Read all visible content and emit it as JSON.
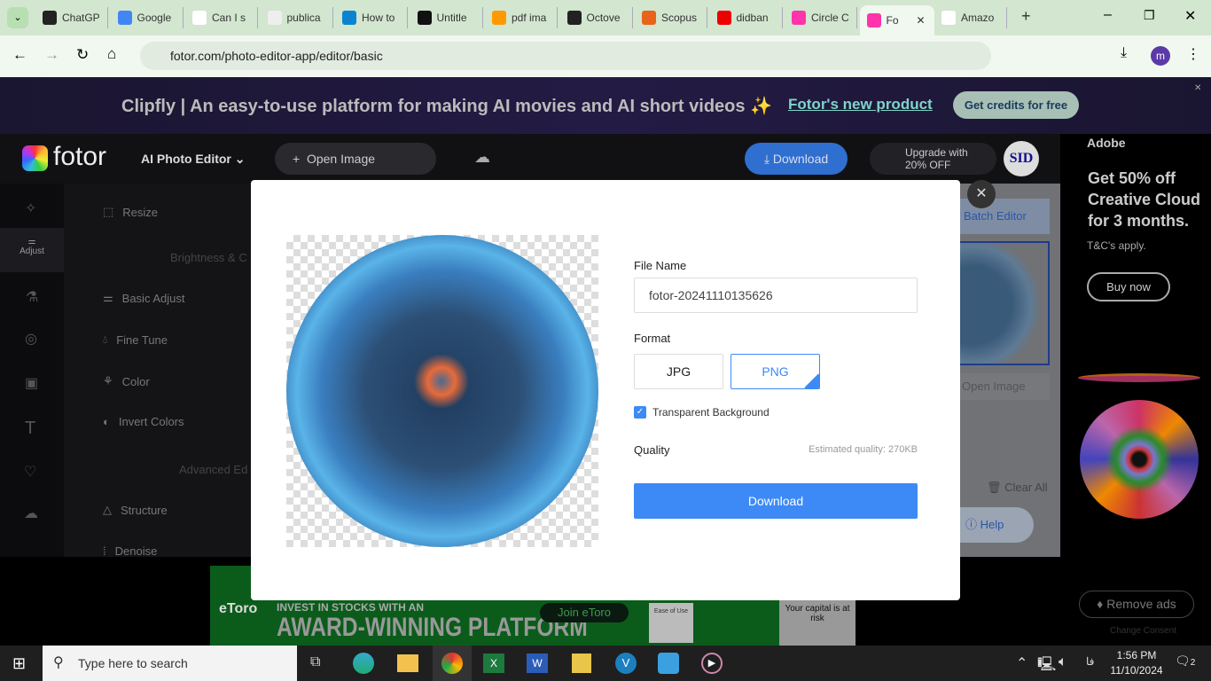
{
  "browser": {
    "tabs": [
      {
        "label": "ChatGP",
        "icon": "chatgpt-icon"
      },
      {
        "label": "Google",
        "icon": "google-translate-icon"
      },
      {
        "label": "Can I s",
        "icon": "google-icon"
      },
      {
        "label": "publica",
        "icon": "publication-icon"
      },
      {
        "label": "How to",
        "icon": "a-icon"
      },
      {
        "label": "Untitle",
        "icon": "untitled-icon"
      },
      {
        "label": "pdf ima",
        "icon": "pdf-icon"
      },
      {
        "label": "Octove",
        "icon": "github-icon"
      },
      {
        "label": "Scopus",
        "icon": "scopus-icon"
      },
      {
        "label": "didban",
        "icon": "youtube-icon"
      },
      {
        "label": "Circle C",
        "icon": "fotor-icon"
      },
      {
        "label": "Fo",
        "icon": "fotor-icon",
        "active": true
      },
      {
        "label": "Amazo",
        "icon": "amazon-icon"
      }
    ],
    "url": "fotor.com/photo-editor-app/editor/basic",
    "profile": "m"
  },
  "banner": {
    "text": "Clipfly | An easy-to-use platform for making AI movies and AI short videos ✨",
    "link": "Fotor's new product",
    "button": "Get credits for free"
  },
  "header": {
    "logo": "fotor",
    "editor": "AI Photo Editor",
    "open_image": "Open Image",
    "download": "Download",
    "upgrade_line1": "Upgrade with",
    "upgrade_line2": "20% OFF",
    "avatar": "SID"
  },
  "rail": {
    "adjust": "Adjust"
  },
  "panel": {
    "resize": "Resize",
    "section1": "Brightness & C",
    "basic": "Basic Adjust",
    "fine": "Fine Tune",
    "color": "Color",
    "invert": "Invert Colors",
    "section2": "Advanced Ed",
    "structure": "Structure",
    "denoise": "Denoise"
  },
  "right_panel": {
    "batch": "Batch Editor",
    "open": "Open Image",
    "clear": "Clear All",
    "help": "Help"
  },
  "modal": {
    "file_name_label": "File Name",
    "file_name": "fotor-20241110135626",
    "format_label": "Format",
    "formats": [
      "JPG",
      "PNG"
    ],
    "selected_format": "PNG",
    "transparent": "Transparent Background",
    "transparent_checked": true,
    "quality_label": "Quality",
    "estimate": "Estimated quality: 270KB",
    "download": "Download"
  },
  "side_ad": {
    "brand": "Adobe",
    "headline": "Get 50% off Creative Cloud for 3 months.",
    "tc": "T&C's apply.",
    "button": "Buy now",
    "remove": "Remove ads",
    "consent": "Change Consent"
  },
  "bottom_ad": {
    "brand": "eToro",
    "line1": "INVEST IN STOCKS WITH AN",
    "line2": "AWARD-WINNING PLATFORM",
    "button": "Join eToro",
    "badge": "Ease of Use",
    "risk": "Your capital is at risk"
  },
  "taskbar": {
    "search": "Type here to search",
    "time": "1:56 PM",
    "date": "11/10/2024",
    "lang": "فا",
    "notifications": "2"
  },
  "colors": {
    "accent": "#3d8af7",
    "ad_green": "#0b5c1b"
  }
}
